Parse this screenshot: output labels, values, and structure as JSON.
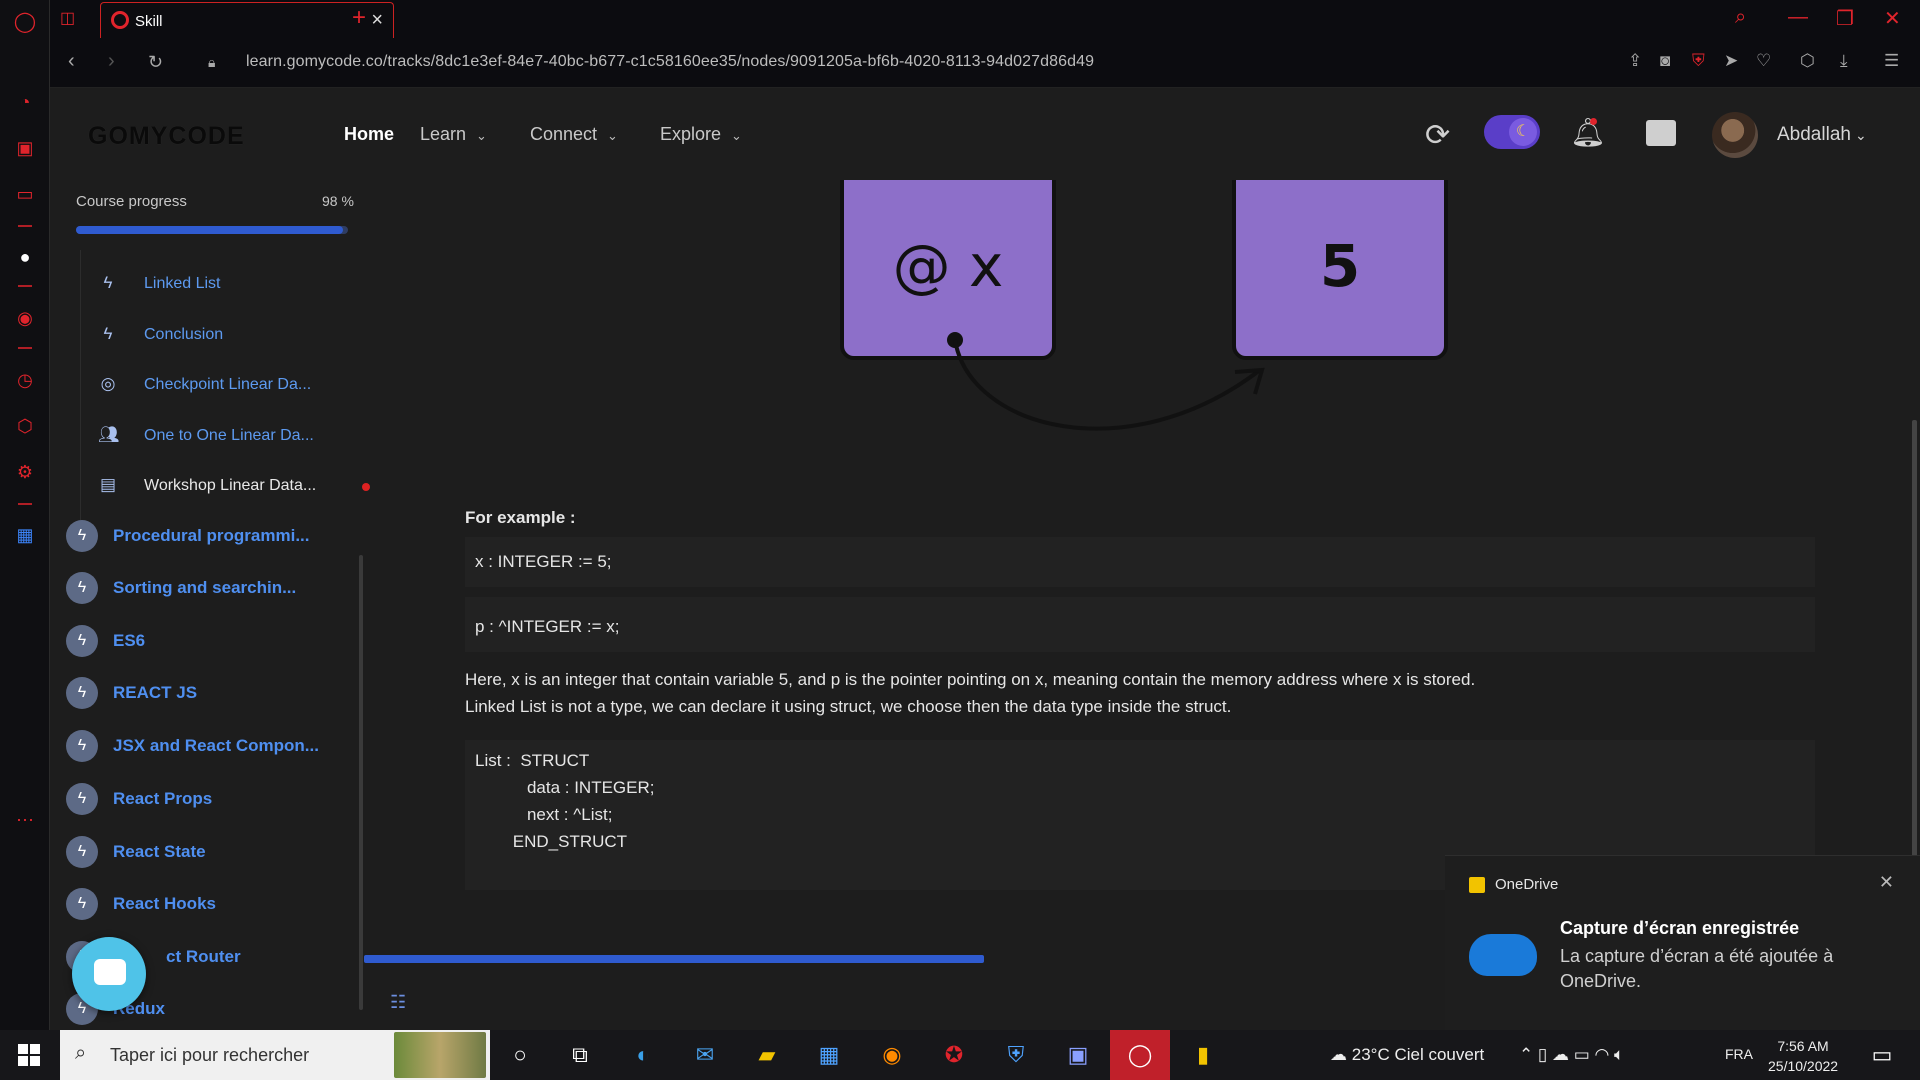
{
  "browser": {
    "tab_title": "Skill",
    "url": "learn.gomycode.co/tracks/8dc1e3ef-84e7-40bc-b677-c1c58160ee35/nodes/9091205a-bf6b-4020-8113-94d027d86d49"
  },
  "header": {
    "logo": "GOMYCODE",
    "menu": {
      "home": "Home",
      "learn": "Learn",
      "connect": "Connect",
      "explore": "Explore"
    },
    "username": "Abdallah"
  },
  "sidebar": {
    "progress_label": "Course progress",
    "progress_value": "98 %",
    "progress_fraction": 0.98,
    "sub_items": [
      {
        "label": "Linked List",
        "icon": "bolt-icon"
      },
      {
        "label": "Conclusion",
        "icon": "bolt-icon"
      },
      {
        "label": "Checkpoint Linear Da...",
        "icon": "target-icon"
      },
      {
        "label": "One to One Linear Da...",
        "icon": "people-icon"
      },
      {
        "label": "Workshop Linear Data...",
        "icon": "workshop-icon"
      }
    ],
    "modules": [
      {
        "label": "Procedural programmi..."
      },
      {
        "label": "Sorting and searchin..."
      },
      {
        "label": "ES6"
      },
      {
        "label": "REACT JS"
      },
      {
        "label": "JSX and React Compon..."
      },
      {
        "label": "React Props"
      },
      {
        "label": "React State"
      },
      {
        "label": "React Hooks"
      },
      {
        "label": "ct Router"
      },
      {
        "label": "Redux"
      }
    ]
  },
  "content": {
    "diagram": {
      "box1": "@ x",
      "box2": "5"
    },
    "for_example": "For example :",
    "code1": "x : INTEGER := 5;",
    "code2": "p : ^INTEGER := x;",
    "para1": "Here, x is an integer that contain variable 5, and p is the pointer pointing on x, meaning contain the memory address where x is stored.",
    "para2": "Linked List is not a type, we can declare it using struct, we choose then the data type inside the struct.",
    "struct_lines": [
      "List :  STRUCT",
      "           data : INTEGER;",
      "           next : ^List;",
      "        END_STRUCT"
    ],
    "reading_progress": 0.35
  },
  "toast": {
    "app": "OneDrive",
    "title": "Capture d’écran enregistrée",
    "body": "La capture d’écran a été ajoutée à OneDrive."
  },
  "taskbar": {
    "search_placeholder": "Taper ici pour rechercher",
    "weather": "23°C  Ciel couvert",
    "lang": "FRA",
    "time": "7:56 AM",
    "date": "25/10/2022"
  },
  "colors": {
    "accent_blue": "#2f5bd0",
    "link_blue": "#4f8ff0",
    "opera_red": "#e0242c",
    "diagram_purple": "#8d6fc9"
  }
}
